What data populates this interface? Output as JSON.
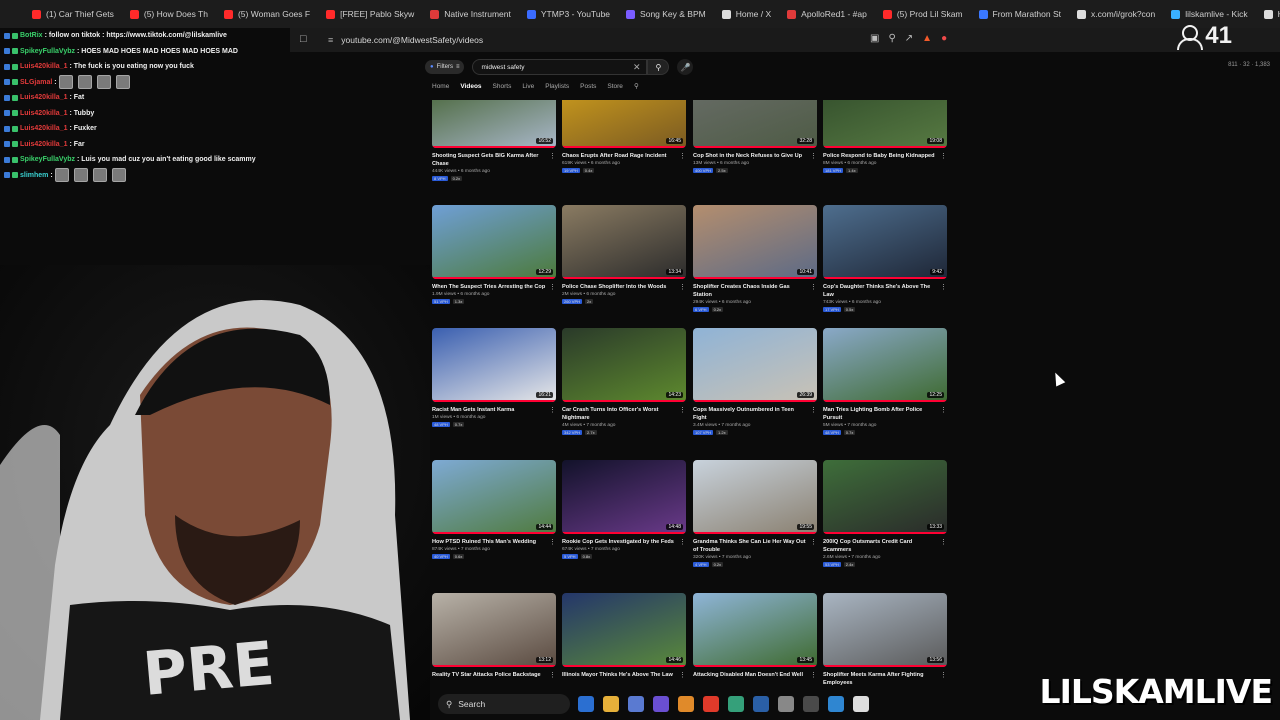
{
  "browser": {
    "tabs": [
      {
        "label": "(1) Car Thief Gets",
        "color": "#ff2a2a"
      },
      {
        "label": "(5) How Does Th",
        "color": "#ff2a2a"
      },
      {
        "label": "(5) Woman Goes F",
        "color": "#ff2a2a"
      },
      {
        "label": "[FREE] Pablo Skyw",
        "color": "#ff2a2a"
      },
      {
        "label": "Native Instrument",
        "color": "#e03a3a"
      },
      {
        "label": "YTMP3 - YouTube",
        "color": "#3a6bff"
      },
      {
        "label": "Song Key & BPM",
        "color": "#7a5cff"
      },
      {
        "label": "Home / X",
        "color": "#dddddd"
      },
      {
        "label": "ApolloRed1 - #ap",
        "color": "#e03a3a"
      },
      {
        "label": "(5) Prod Lil Skam",
        "color": "#ff2a2a"
      },
      {
        "label": "From Marathon St",
        "color": "#3a78ff"
      },
      {
        "label": "x.com/i/grok?con",
        "color": "#dddddd"
      },
      {
        "label": "lilskamlive - Kick",
        "color": "#3ab0ff"
      },
      {
        "label": "Home / X",
        "color": "#dddddd"
      }
    ],
    "url": "youtube.com/@MidwestSafety/videos"
  },
  "stream": {
    "viewer_count": "41",
    "stats_text": "811 · 32 · 1,383",
    "brand": "LILSKAMLIVE"
  },
  "chat": [
    {
      "user": "BotRix",
      "color": "#3ad16b",
      "text": ": follow on tiktok : https://www.tiktok.com/@lilskamlive"
    },
    {
      "user": "SpikeyFullaVybz",
      "color": "#3ad16b",
      "text": ": HOES MAD HOES MAD HOES MAD HOES MAD"
    },
    {
      "user": "Luis420killa_1",
      "color": "#e23a3a",
      "text": ": The fuck is you eating now you fuck"
    },
    {
      "user": "SLGjamal",
      "color": "#e23a3a",
      "text": ":",
      "emotes": 4
    },
    {
      "user": "Luis420killa_1",
      "color": "#e23a3a",
      "text": ": Fat"
    },
    {
      "user": "Luis420killa_1",
      "color": "#e23a3a",
      "text": ": Tubby"
    },
    {
      "user": "Luis420killa_1",
      "color": "#e23a3a",
      "text": ": Fuxker"
    },
    {
      "user": "Luis420killa_1",
      "color": "#e23a3a",
      "text": ": Far"
    },
    {
      "user": "SpikeyFullaVybz",
      "color": "#3ad16b",
      "text": ": Luis you mad cuz you ain't eating good like scammy"
    },
    {
      "user": "slimhem",
      "color": "#3ad1d1",
      "text": ":",
      "emotes": 4
    }
  ],
  "youtube": {
    "filters_label": "Filters",
    "search_value": "midwest safety",
    "channel_tabs": [
      "Home",
      "Videos",
      "Shorts",
      "Live",
      "Playlists",
      "Posts",
      "Store"
    ],
    "active_tab": "Videos",
    "rows": [
      [
        {
          "title": "Shooting Suspect Gets BIG Karma After Chase",
          "meta": "444K views • 6 months ago",
          "duration": "16:52",
          "tags": [
            "8 VPH",
            "0.2x"
          ],
          "colors": [
            "#3e5d2a",
            "#a9b7c9"
          ],
          "progress": 1.0
        },
        {
          "title": "Chaos Erupts After Road Rage Incident",
          "meta": "619K views • 6 months ago",
          "duration": "16:45",
          "tags": [
            "19 VPH",
            "0.4x"
          ],
          "colors": [
            "#d4a21c",
            "#7a5a22"
          ],
          "progress": 1.0
        },
        {
          "title": "Cop Shot in the Neck Refuses to Give Up",
          "meta": "13M views • 6 months ago",
          "duration": "32:28",
          "tags": [
            "400 VPH",
            "2.5x"
          ],
          "colors": [
            "#6a6e6a",
            "#4e5b45"
          ],
          "progress": 1.0
        },
        {
          "title": "Police Respond to Baby Being Kidnapped",
          "meta": "8M views • 6 months ago",
          "duration": "19:08",
          "tags": [
            "181 VPH",
            "1.4x"
          ],
          "colors": [
            "#2f4a2a",
            "#577a42"
          ],
          "progress": 1.0
        }
      ],
      [
        {
          "title": "When The Suspect Tries Arresting the Cop",
          "meta": "1.9M views • 6 months ago",
          "duration": "12:29",
          "tags": [
            "51 VPH",
            "1.3x"
          ],
          "colors": [
            "#6f9fd6",
            "#4c7a3a"
          ],
          "progress": 1.0
        },
        {
          "title": "Police Chase Shoplifter Into the Woods",
          "meta": "2M views • 6 months ago",
          "duration": "13:34",
          "tags": [
            "260 VPH",
            "2x"
          ],
          "colors": [
            "#8a7b62",
            "#2b2b2b"
          ],
          "progress": 1.0
        },
        {
          "title": "Shoplifter Creates Chaos Inside Gas Station",
          "meta": "294K views • 6 months ago",
          "duration": "10:41",
          "tags": [
            "6 VPH",
            "0.2x"
          ],
          "colors": [
            "#b48e6e",
            "#5c6a86"
          ],
          "progress": 1.0
        },
        {
          "title": "Cop's Daughter Thinks She's Above The Law",
          "meta": "743K views • 6 months ago",
          "duration": "9:42",
          "tags": [
            "17 VPH",
            "0.5x"
          ],
          "colors": [
            "#4e6e8e",
            "#1e2636"
          ],
          "progress": 1.0
        }
      ],
      [
        {
          "title": "Racist Man Gets Instant Karma",
          "meta": "1M views • 6 months ago",
          "duration": "16:21",
          "tags": [
            "48 VPH",
            "0.7x"
          ],
          "colors": [
            "#3a5fb0",
            "#e8e8e8"
          ],
          "progress": 1.0
        },
        {
          "title": "Car Crash Turns Into Officer's Worst Nightmare",
          "meta": "4M views • 7 months ago",
          "duration": "14:23",
          "tags": [
            "342 VPH",
            "2.7x"
          ],
          "colors": [
            "#2a3a2a",
            "#5e8a2e"
          ],
          "progress": 1.0
        },
        {
          "title": "Cops Massively Outnumbered in Teen Fight",
          "meta": "3.4M views • 7 months ago",
          "duration": "26:39",
          "tags": [
            "107 VPH",
            "1.2x"
          ],
          "colors": [
            "#8fb3d6",
            "#c9c2b5"
          ],
          "progress": 1.0
        },
        {
          "title": "Man Tries Lighting Bomb After Police Pursuit",
          "meta": "5M views • 7 months ago",
          "duration": "12:25",
          "tags": [
            "48 VPH",
            "0.7x"
          ],
          "colors": [
            "#8aa9c9",
            "#3e6a30"
          ],
          "progress": 1.0
        }
      ],
      [
        {
          "title": "How PTSD Ruined This Man's Wedding",
          "meta": "874K views • 7 months ago",
          "duration": "14:44",
          "tags": [
            "40 VPH",
            "0.6x"
          ],
          "colors": [
            "#7eaad4",
            "#4f7a3d"
          ],
          "progress": 1.0
        },
        {
          "title": "Rookie Cop Gets Investigated by the Feds",
          "meta": "674K views • 7 months ago",
          "duration": "14:48",
          "tags": [
            "5 VPH",
            "0.8x"
          ],
          "colors": [
            "#12122a",
            "#6a3a8a"
          ],
          "progress": 1.0
        },
        {
          "title": "Grandma Thinks She Can Lie Her Way Out of Trouble",
          "meta": "320K views • 7 months ago",
          "duration": "19:55",
          "tags": [
            "4 VPH",
            "0.2x"
          ],
          "colors": [
            "#c8d2dc",
            "#8a8070"
          ],
          "progress": 1.0
        },
        {
          "title": "200IQ Cop Outsmarts Credit Card Scammers",
          "meta": "2.6M views • 7 months ago",
          "duration": "13:33",
          "tags": [
            "53 VPH",
            "2.4x"
          ],
          "colors": [
            "#3e6e3a",
            "#2a2a2a"
          ],
          "progress": 1.0
        }
      ],
      [
        {
          "title": "Reality TV Star Attacks Police Backstage",
          "meta": "",
          "duration": "13:12",
          "tags": [],
          "colors": [
            "#b8b2a8",
            "#5a4a40"
          ],
          "progress": 1.0
        },
        {
          "title": "Illinois Mayor Thinks He's Above The Law",
          "meta": "",
          "duration": "14:46",
          "tags": [],
          "colors": [
            "#24366a",
            "#5a8a3a"
          ],
          "progress": 1.0
        },
        {
          "title": "Attacking Disabled Man Doesn't End Well",
          "meta": "",
          "duration": "13:45",
          "tags": [],
          "colors": [
            "#8fb5d8",
            "#3e6a2e"
          ],
          "progress": 1.0
        },
        {
          "title": "Shoplifter Meets Karma After Fighting Employees",
          "meta": "",
          "duration": "13:56",
          "tags": [],
          "colors": [
            "#a9b5c2",
            "#5a5a5a"
          ],
          "progress": 1.0
        }
      ]
    ]
  },
  "taskbar": {
    "search_label": "Search",
    "icon_colors": [
      "#2b6fd1",
      "#e6b03a",
      "#5a7ad1",
      "#6a4fd1",
      "#e08a2a",
      "#e03a2a",
      "#35a07a",
      "#2a5fa6",
      "#888888",
      "#4a4a4a",
      "#2f86d1",
      "#dddddd"
    ]
  }
}
